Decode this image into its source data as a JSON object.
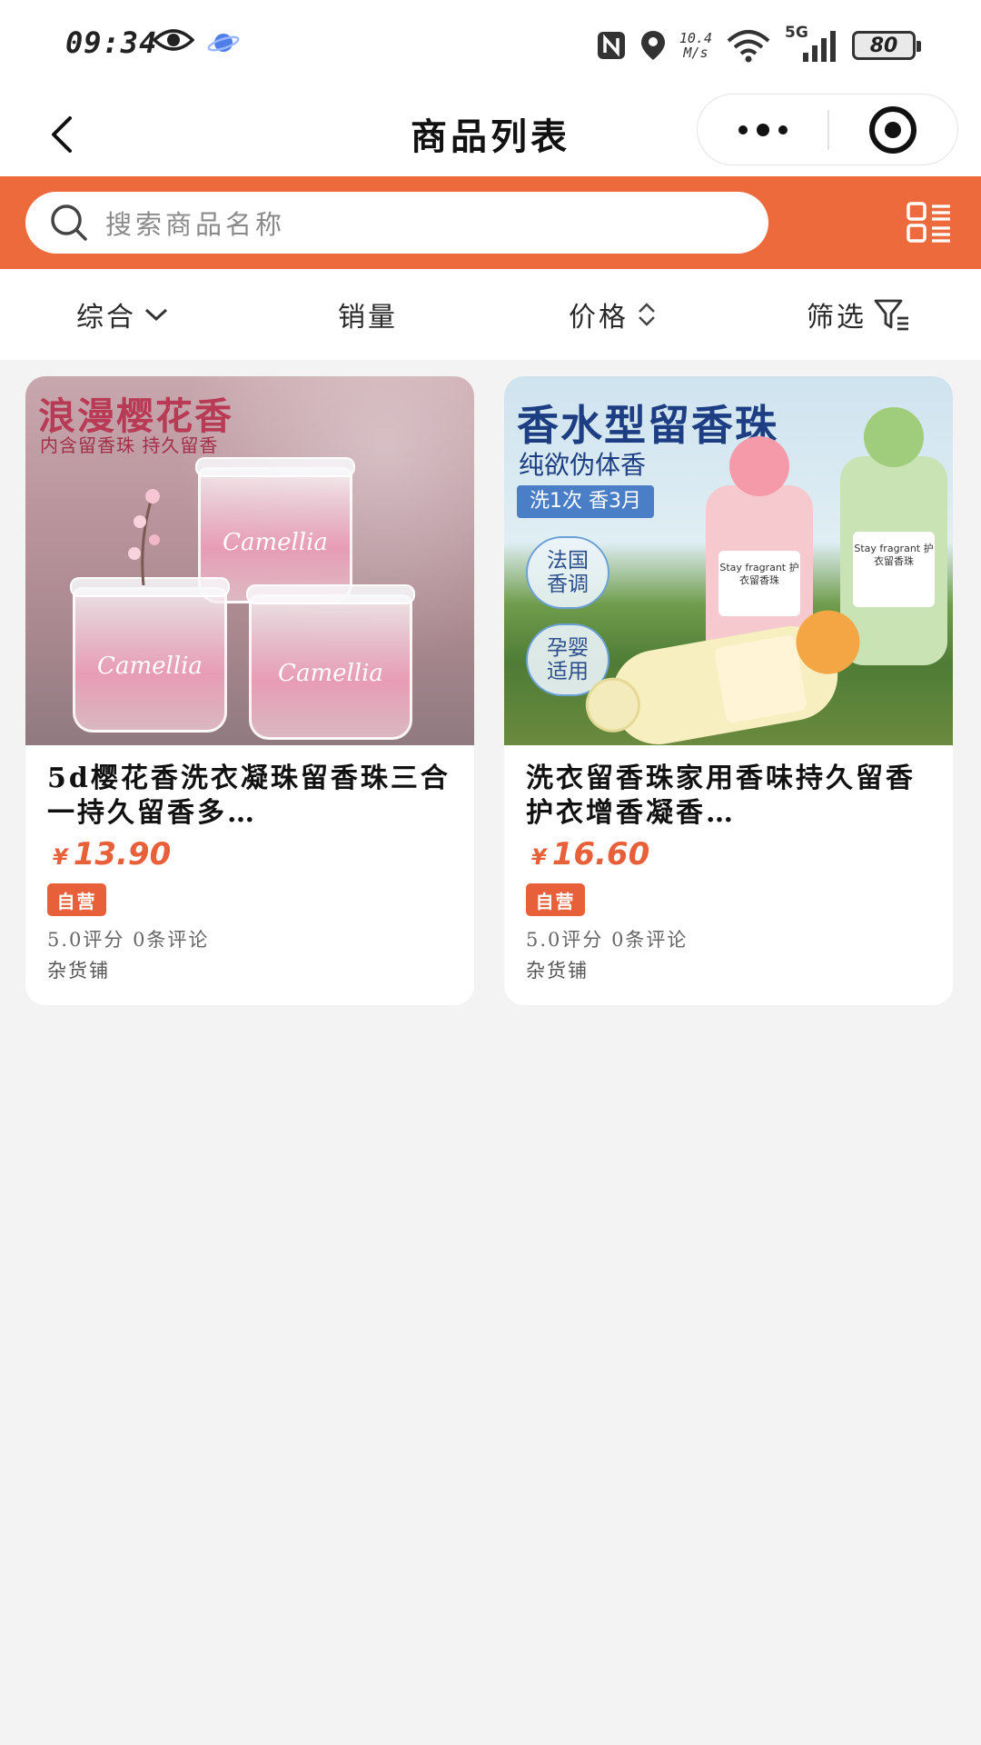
{
  "status_bar": {
    "time": "09:34",
    "net_speed_value": "10.4",
    "net_speed_unit": "M/s",
    "network": "5G",
    "battery": "80",
    "icons": [
      "eye-icon",
      "planet-icon",
      "nfc-icon",
      "location-icon",
      "wifi-icon",
      "signal-icon",
      "battery-icon"
    ]
  },
  "nav": {
    "title": "商品列表",
    "icons": [
      "back-icon",
      "more-icon",
      "close-target-icon"
    ]
  },
  "search": {
    "placeholder": "搜索商品名称",
    "icons": [
      "search-icon",
      "grid-list-toggle-icon"
    ]
  },
  "filters": [
    {
      "label": "综合",
      "icon": "chevron-down-icon"
    },
    {
      "label": "销量"
    },
    {
      "label": "价格",
      "icon": "sort-updown-icon"
    },
    {
      "label": "筛选",
      "icon": "filter-icon"
    }
  ],
  "products": [
    {
      "title": "5d樱花香洗衣凝珠留香珠三合一持久留香多…",
      "currency": "¥",
      "price": "13.90",
      "tag": "自营",
      "rating": "5.0评分 0条评论",
      "shop": "杂货铺",
      "image": {
        "headline": "浪漫樱花香",
        "subline": "内含留香珠  持久留香",
        "jar_text": "Camellia"
      }
    },
    {
      "title": "洗衣留香珠家用香味持久留香护衣增香凝香…",
      "currency": "¥",
      "price": "16.60",
      "tag": "自营",
      "rating": "5.0评分 0条评论",
      "shop": "杂货铺",
      "image": {
        "headline": "香水型留香珠",
        "subline": "纯欲伪体香",
        "pill": "洗1次 香3月",
        "badge1_line1": "法国",
        "badge1_line2": "香调",
        "badge2_line1": "孕婴",
        "badge2_line2": "适用",
        "bottle_label": "Stay fragrant 护衣留香珠"
      }
    }
  ],
  "colors": {
    "accent": "#ec6a3c",
    "price": "#e8603a",
    "background": "#f4f3f4"
  }
}
